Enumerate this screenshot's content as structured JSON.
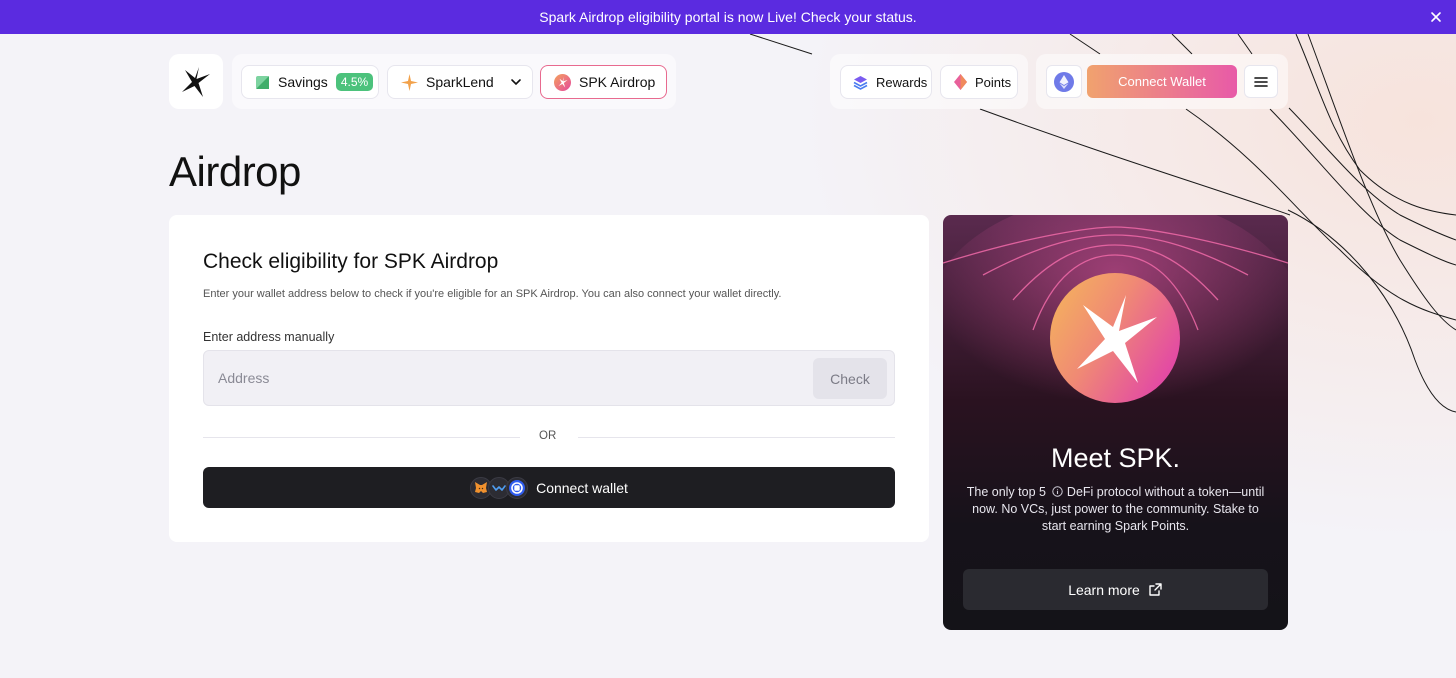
{
  "banner": {
    "text": "Spark Airdrop eligibility portal is now Live! Check your status."
  },
  "nav": {
    "savings": {
      "label": "Savings",
      "rate": "4.5%"
    },
    "sparklend": {
      "label": "SparkLend"
    },
    "airdrop": {
      "label": "SPK Airdrop"
    },
    "rewards": {
      "label": "Rewards"
    },
    "points": {
      "label": "Points"
    },
    "connect": {
      "label": "Connect Wallet"
    }
  },
  "page": {
    "title": "Airdrop"
  },
  "eligibility": {
    "title": "Check eligibility for SPK Airdrop",
    "subtitle": "Enter your wallet address below to check if you're eligible for an SPK Airdrop. You can also connect your wallet directly.",
    "address_label": "Enter address manually",
    "address_placeholder": "Address",
    "check_label": "Check",
    "or_text": "OR",
    "connect_label": "Connect wallet"
  },
  "promo": {
    "title": "Meet SPK.",
    "text_before": "The only top 5",
    "text_after": " DeFi protocol without a token—until now. No VCs, just power to the community. Stake to start earning Spark Points.",
    "learn_label": "Learn more"
  },
  "colors": {
    "banner": "#5b2be0",
    "accent_gradient_start": "#f0a26e",
    "accent_gradient_end": "#e85aa8",
    "badge": "#4cc27c"
  },
  "icons": [
    "close-icon",
    "spark-logo-icon",
    "savings-icon",
    "sparklend-icon",
    "chevron-down-icon",
    "spk-icon",
    "rewards-icon",
    "points-icon",
    "ethereum-icon",
    "menu-icon",
    "metamask-icon",
    "walletconnect-icon",
    "coinbase-icon",
    "info-icon",
    "external-link-icon"
  ]
}
